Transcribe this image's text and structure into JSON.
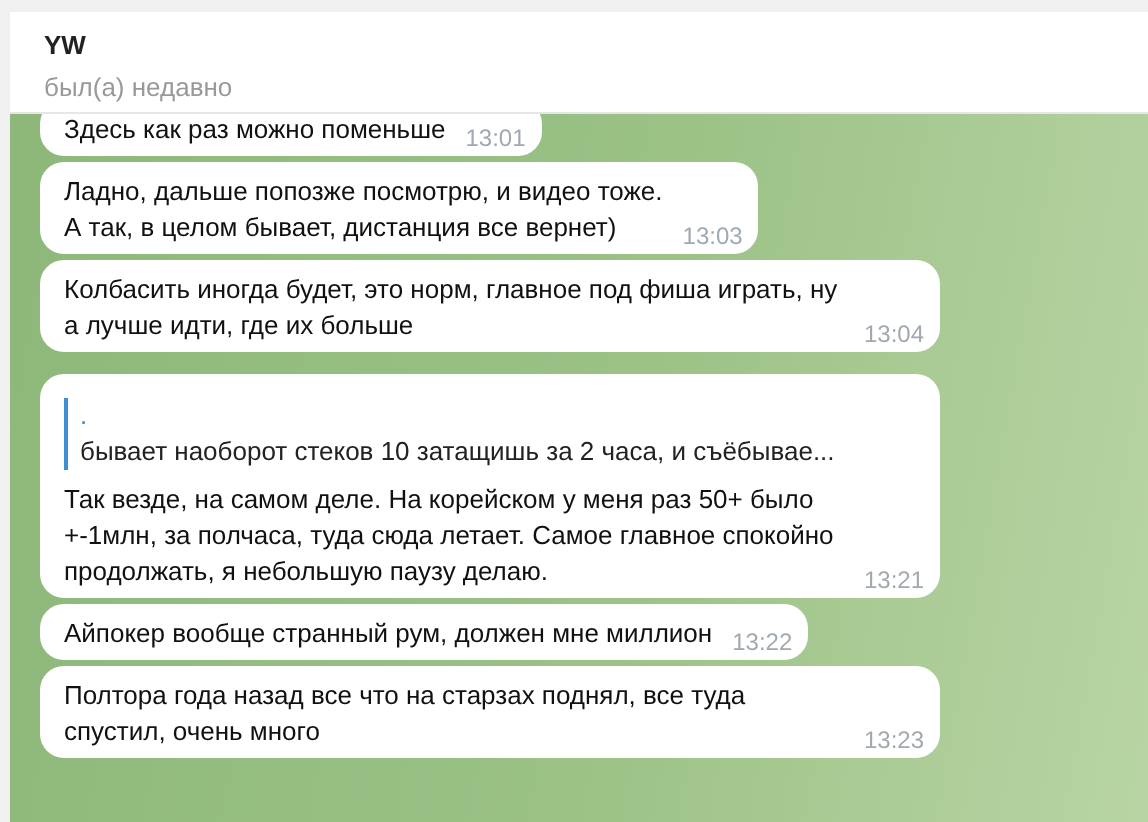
{
  "header": {
    "title": "YW",
    "status": "был(а) недавно"
  },
  "messages": [
    {
      "text": "Здесь как раз можно поменьше",
      "time": "13:01"
    },
    {
      "text": "Ладно, дальше попозже посмотрю, и видео тоже.\nА так, в целом бывает, дистанция все вернет)",
      "time": "13:03"
    },
    {
      "text": "Колбасить иногда будет, это норм, главное под фиша играть, ну а лучше идти, где их больше",
      "time": "13:04"
    },
    {
      "reply": {
        "title": ".",
        "text": "бывает наоборот стеков 10 затащишь за 2 часа, и съёбывае..."
      },
      "text": "Так везде, на самом деле. На корейском у меня раз 50+ было +-1млн, за полчаса, туда сюда летает. Самое главное спокойно продолжать, я небольшую паузу делаю.",
      "time": "13:21"
    },
    {
      "text": "Айпокер вообще странный рум, должен мне миллион",
      "time": "13:22"
    },
    {
      "text": "Полтора года назад все что на старзах поднял, все туда спустил, очень много",
      "time": "13:23"
    }
  ]
}
